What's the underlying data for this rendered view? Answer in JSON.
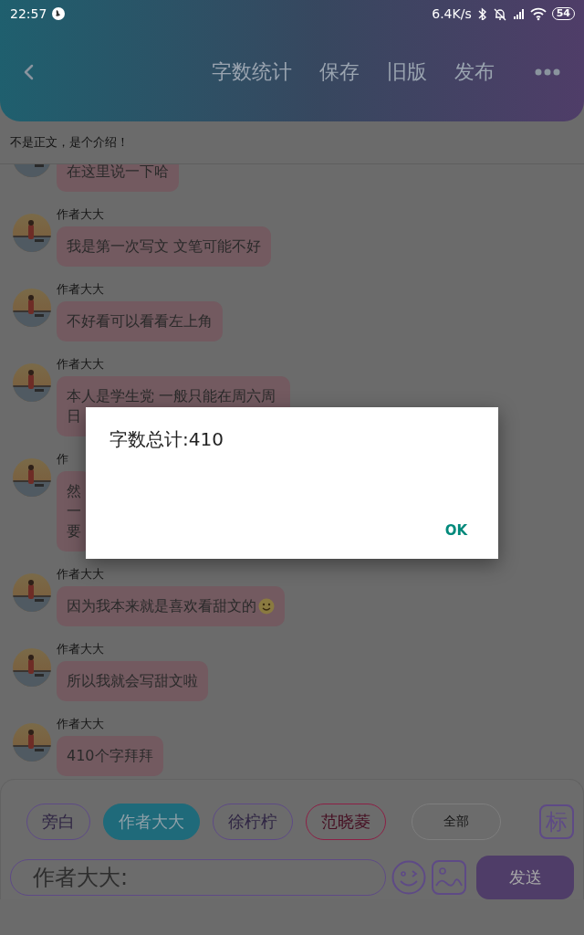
{
  "status_bar": {
    "time": "22:57",
    "speed": "6.4K/s",
    "battery": "54"
  },
  "header": {
    "actions": [
      "字数统计",
      "保存",
      "旧版",
      "发布"
    ]
  },
  "intro": "不是正文，是个介绍！",
  "messages": [
    {
      "kind": "plain",
      "text": "在这里说一下哈",
      "smiley": false
    },
    {
      "kind": "plain",
      "sender": "作者大大",
      "text": "我是第一次写文 文笔可能不好",
      "smiley": false
    },
    {
      "kind": "plain",
      "sender": "作者大大",
      "text": "不好看可以看看左上角",
      "smiley": false
    },
    {
      "kind": "plain",
      "sender": "作者大大",
      "text": "本人是学生党 一般只能在周六周日",
      "smiley": false
    },
    {
      "kind": "covered",
      "sender": "作",
      "text": "然一要",
      "smiley": false
    },
    {
      "kind": "plain",
      "sender": "作者大大",
      "text": "因为我本来就是喜欢看甜文的",
      "smiley": true
    },
    {
      "kind": "plain",
      "sender": "作者大大",
      "text": "所以我就会写甜文啦",
      "smiley": false
    },
    {
      "kind": "plain",
      "sender": "作者大大",
      "text": "410个字拜拜",
      "smiley": false
    }
  ],
  "roles": [
    {
      "label": "旁白",
      "color": "#5e4a86",
      "selected": false
    },
    {
      "label": "作者大大",
      "color": "#1f6a7a",
      "selected": true
    },
    {
      "label": "徐柠柠",
      "color": "#5e4a86",
      "selected": false
    },
    {
      "label": "范晓菱",
      "color": "#8c1f45",
      "selected": false
    }
  ],
  "filter_button": "全部",
  "mark_button": "标",
  "input": {
    "placeholder": "作者大大:"
  },
  "send_button": "发送",
  "dialog": {
    "message": "字数总计:410",
    "button": "OK"
  }
}
